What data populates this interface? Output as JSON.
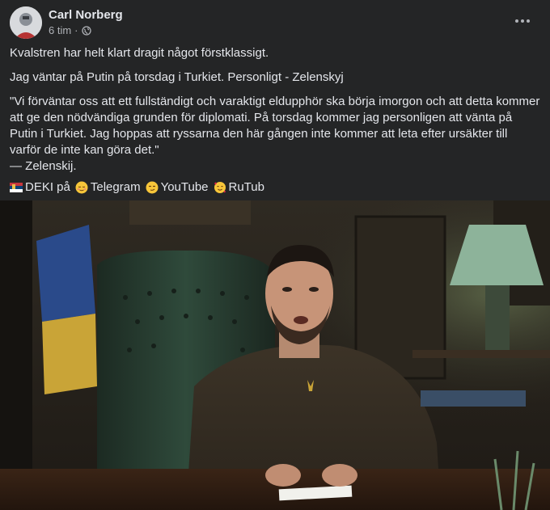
{
  "post": {
    "author": "Carl Norberg",
    "time": "6 tim",
    "separator": "·",
    "privacy_icon": "globe-icon",
    "more_icon": "more-horizontal-icon",
    "paragraphs": [
      "Kvalstren har helt klart dragit något förstklassigt.",
      "Jag väntar på Putin på torsdag i Turkiet. Personligt - Zelenskyj"
    ],
    "quote_lines": [
      "\"Vi förväntar oss att ett fullständigt och varaktigt eldupphör ska börja imorgon och att detta kommer",
      "att ge den nödvändiga grunden för diplomati. På torsdag kommer jag personligen att vänta på",
      "Putin i Turkiet. Jag hoppas att ryssarna den här gången inte kommer att leta efter ursäkter till",
      "varför de inte kan göra det.\"",
      "— Zelenskij."
    ],
    "links": {
      "prefix": "DEKI på",
      "telegram": "Telegram",
      "youtube": "YouTube",
      "rutube": "RuTub"
    }
  },
  "colors": {
    "background": "#242526",
    "text": "#e4e6eb",
    "secondary_text": "#b0b3b8"
  }
}
